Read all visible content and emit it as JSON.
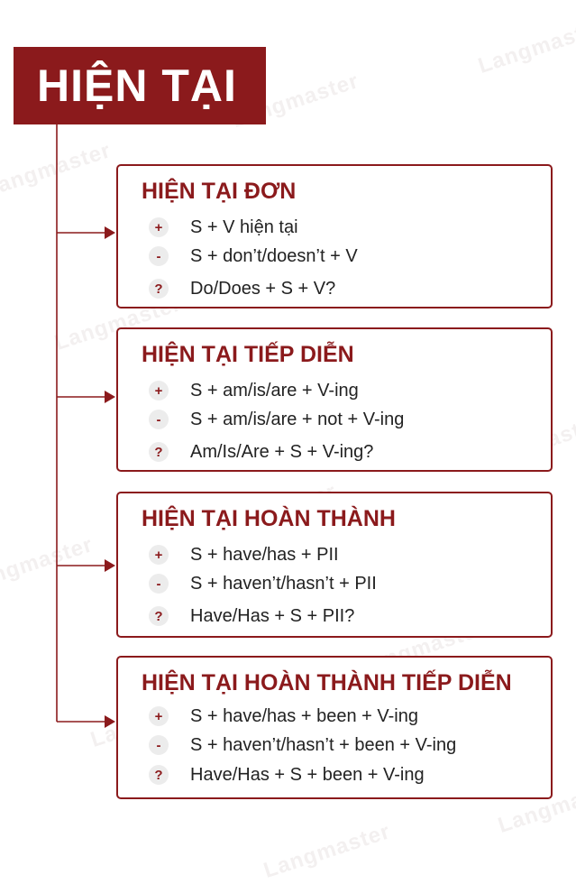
{
  "colors": {
    "accent": "#8b1a1c",
    "badge_bg": "#ececec",
    "text": "#222222"
  },
  "watermark_text": "Langmaster",
  "title": "HIỆN TẠI",
  "tenses": [
    {
      "name": "HIỆN TẠI ĐƠN",
      "rows": [
        {
          "sign": "+",
          "formula": "S + V hiện tại"
        },
        {
          "sign": "-",
          "formula": "S + don’t/doesn’t + V"
        },
        {
          "sign": "?",
          "formula": "Do/Does + S + V?"
        }
      ]
    },
    {
      "name": "HIỆN TẠI TIẾP DIỄN",
      "rows": [
        {
          "sign": "+",
          "formula": "S + am/is/are + V-ing"
        },
        {
          "sign": "-",
          "formula": "S + am/is/are + not + V-ing"
        },
        {
          "sign": "?",
          "formula": "Am/Is/Are + S + V-ing?"
        }
      ]
    },
    {
      "name": "HIỆN TẠI HOÀN THÀNH",
      "rows": [
        {
          "sign": "+",
          "formula": "S + have/has + PII"
        },
        {
          "sign": "-",
          "formula": "S + haven’t/hasn’t + PII"
        },
        {
          "sign": "?",
          "formula": "Have/Has + S + PII?"
        }
      ]
    },
    {
      "name": "HIỆN TẠI HOÀN THÀNH TIẾP DIỄN",
      "rows": [
        {
          "sign": "+",
          "formula": "S + have/has + been + V-ing"
        },
        {
          "sign": "-",
          "formula": "S + haven’t/hasn’t + been + V-ing"
        },
        {
          "sign": "?",
          "formula": "Have/Has + S + been + V-ing"
        }
      ]
    }
  ]
}
